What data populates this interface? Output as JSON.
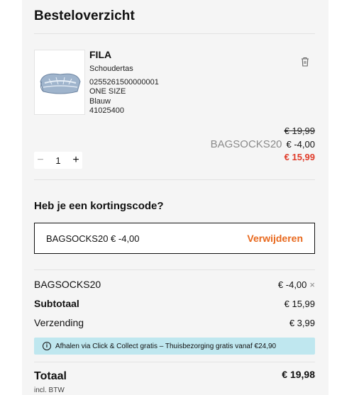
{
  "header": {
    "title": "Besteloverzicht"
  },
  "product": {
    "brand": "FILA",
    "name": "Schoudertas",
    "sku": "0255261500000001",
    "size": "ONE SIZE",
    "color": "Blauw",
    "article": "41025400",
    "image_icon": "bag-image",
    "price_original": "€ 19,99",
    "discount_code": "BAGSOCKS20",
    "discount_amount": "€ -4,00",
    "price_final": "€ 15,99",
    "quantity": "1"
  },
  "promo": {
    "heading": "Heb je een kortingscode?",
    "applied_value": "BAGSOCKS20 € -4,00",
    "remove_label": "Verwijderen"
  },
  "summary": {
    "discount_label": "BAGSOCKS20",
    "discount_value": "€ -4,00",
    "subtotal_label": "Subtotaal",
    "subtotal_value": "€ 15,99",
    "shipping_label": "Verzending",
    "shipping_value": "€ 3,99",
    "info_text": "Afhalen via Click & Collect gratis – Thuisbezorging gratis vanaf €24,90",
    "total_label": "Totaal",
    "total_value": "€ 19,98",
    "incl_vat": "incl. BTW"
  },
  "colors": {
    "accent": "#e8691e",
    "price_red": "#e03c2a",
    "info_bg": "#bfe7ef"
  }
}
